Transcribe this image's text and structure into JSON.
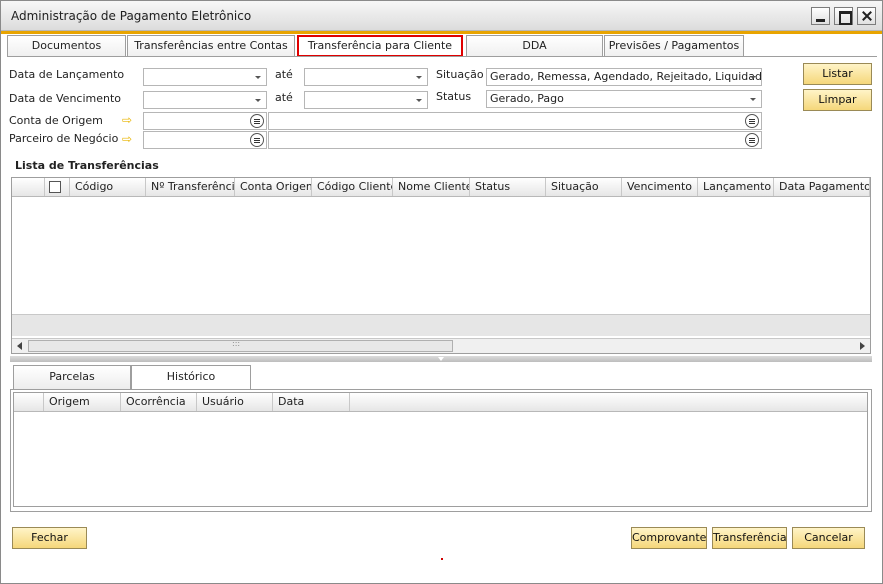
{
  "window": {
    "title": "Administração de Pagamento Eletrônico"
  },
  "tabs": [
    {
      "label": "Documentos"
    },
    {
      "label": "Transferências entre Contas"
    },
    {
      "label": "Transferência para Cliente"
    },
    {
      "label": "DDA"
    },
    {
      "label": "Previsões / Pagamentos"
    }
  ],
  "active_tab": "Transferência para Cliente",
  "filters": {
    "data_lancamento_label": "Data de Lançamento",
    "data_vencimento_label": "Data de Vencimento",
    "ate_label": "até",
    "conta_origem_label": "Conta de Origem",
    "parceiro_label": "Parceiro de Negócio",
    "situacao_label": "Situação",
    "situacao_value": "Gerado, Remessa, Agendado, Rejeitado, Liquidad...",
    "status_label": "Status",
    "status_value": "Gerado, Pago"
  },
  "buttons": {
    "listar": "Listar",
    "limpar": "Limpar",
    "fechar": "Fechar",
    "comprovante": "Comprovante",
    "transferencia": "Transferência",
    "cancelar": "Cancelar"
  },
  "transfer_list": {
    "title": "Lista de Transferências",
    "columns": [
      "Código",
      "Nº Transferência",
      "Conta Origem",
      "Código Cliente",
      "Nome Cliente",
      "Status",
      "Situação",
      "Vencimento",
      "Lançamento",
      "Data Pagamento"
    ]
  },
  "bottom_tabs": [
    {
      "label": "Parcelas"
    },
    {
      "label": "Histórico"
    }
  ],
  "active_bottom_tab": "Histórico",
  "history": {
    "columns": [
      "Origem",
      "Ocorrência",
      "Usuário",
      "Data"
    ]
  },
  "colors": {
    "accent": "#e8a400",
    "active_tab_border": "#e00000",
    "button_fill": "#f5d77a"
  }
}
